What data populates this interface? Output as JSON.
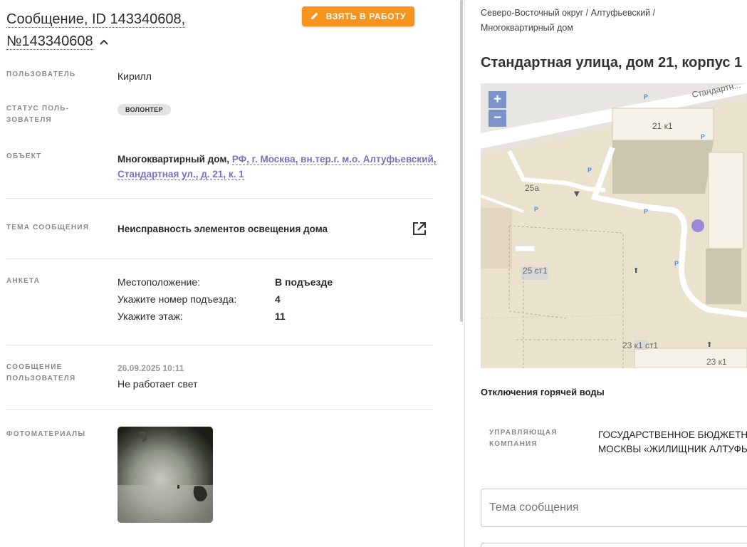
{
  "header": {
    "title_line1": "Сообщение, ID 143340608,",
    "title_line2": "№143340608",
    "take_button": "ВЗЯТЬ В РАБОТУ"
  },
  "fields": {
    "user_label": "ПОЛЬЗОВАТЕЛЬ",
    "user_value": "Кирилл",
    "status_label_1": "СТАТУС ПОЛЬ-",
    "status_label_2": "ЗОВАТЕЛЯ",
    "status_badge": "ВОЛОНТЕР",
    "object_label": "ОБЪЕКТ",
    "object_type": "Многоквартирный дом,",
    "object_link_1": "РФ, г. Москва, вн.тер.г. м.о. Алтуфьевский,",
    "object_link_2": "Стандартная ул., д. 21, к. 1",
    "topic_label": "ТЕМА СООБЩЕНИЯ",
    "topic_value": "Неисправность элементов освещения дома",
    "survey_label": "АНКЕТА",
    "survey": [
      {
        "q": "Местоположение:",
        "a": "В подъезде"
      },
      {
        "q": "Укажите номер подъезда:",
        "a": "4"
      },
      {
        "q": "Укажите этаж:",
        "a": "11"
      }
    ],
    "message_label_1": "СООБЩЕНИЕ",
    "message_label_2": "ПОЛЬЗОВАТЕЛЯ",
    "message_date": "26.09.2025 10:11",
    "message_text": "Не работает свет",
    "photos_label": "ФОТОМАТЕРИАЛЫ"
  },
  "right": {
    "breadcrumb_1": "Северо-Восточный округ / Алтуфьевский /",
    "breadcrumb_2": "Многоквартирный дом",
    "address": "Стандартная улица, дом 21, корпус 1",
    "map": {
      "zoom_in": "+",
      "zoom_out": "−",
      "street": "Стандартн...",
      "labels": [
        "21 к1",
        "25а",
        "25 ст1",
        "23 к1 ст1",
        "23 к1"
      ],
      "marker_color": "#9b88d9"
    },
    "hot_water": "Отключения горячей воды",
    "company_label_1": "УПРАВЛЯЮЩАЯ",
    "company_label_2": "КОМПАНИЯ",
    "company_value_1": "ГОСУДАРСТВЕННОЕ БЮДЖЕТНО",
    "company_value_2": "МОСКВЫ «ЖИЛИЩНИК АЛТУФЬ",
    "topic_input_placeholder": "Тема сообщения"
  },
  "colors": {
    "accent": "#f7941d",
    "link": "#7b6fc2"
  }
}
